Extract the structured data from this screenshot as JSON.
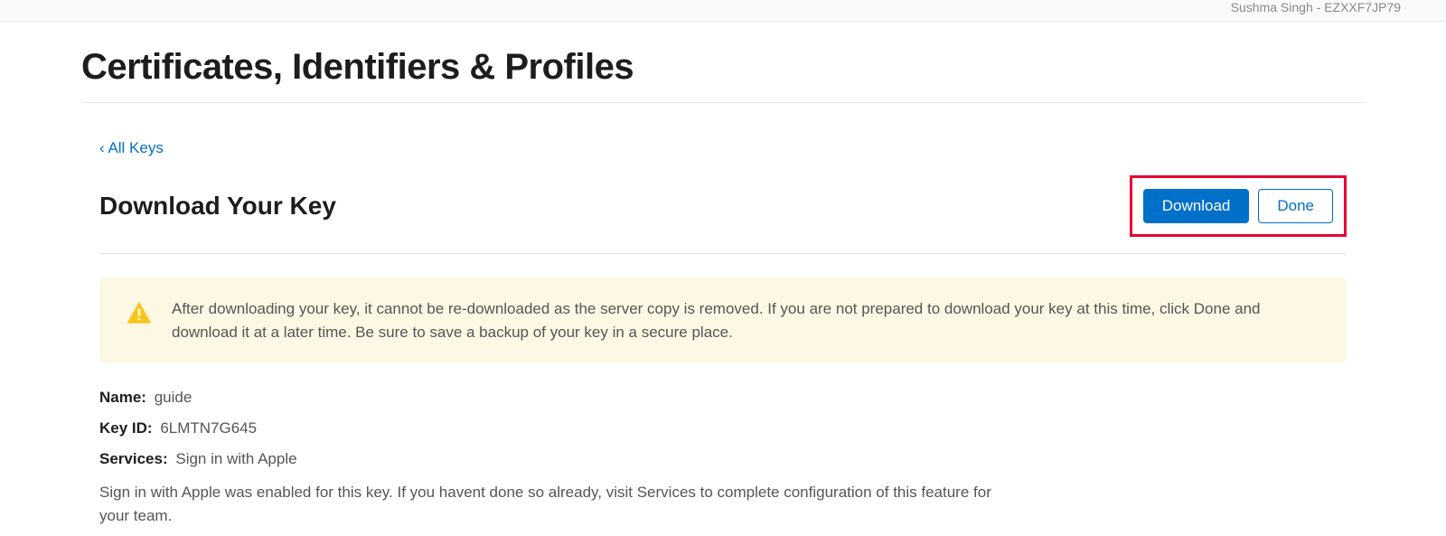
{
  "topbar": {
    "user_text": "Sushma Singh - EZXXF7JP79"
  },
  "page": {
    "title": "Certificates, Identifiers & Profiles"
  },
  "back": {
    "label": "‹ All Keys"
  },
  "section": {
    "title": "Download Your Key"
  },
  "buttons": {
    "download": "Download",
    "done": "Done"
  },
  "warning": {
    "text": "After downloading your key, it cannot be re-downloaded as the server copy is removed. If you are not prepared to download your key at this time, click Done and download it at a later time. Be sure to save a backup of your key in a secure place."
  },
  "details": {
    "name_label": "Name:",
    "name_value": "guide",
    "keyid_label": "Key ID:",
    "keyid_value": "6LMTN7G645",
    "services_label": "Services:",
    "services_value": "Sign in with Apple"
  },
  "footnote": {
    "text": "Sign in with Apple was enabled for this key. If you havent done so already, visit Services to complete configuration of this feature for your team."
  }
}
